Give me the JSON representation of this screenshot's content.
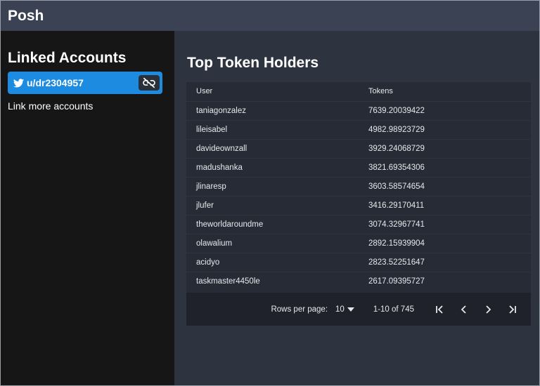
{
  "app": {
    "title": "Posh"
  },
  "sidebar": {
    "heading": "Linked Accounts",
    "account": {
      "username": "u/dr2304957",
      "icon": "twitter-icon",
      "action_icon": "unlink-icon"
    },
    "link_more": "Link more accounts"
  },
  "main": {
    "title": "Top Token Holders",
    "table": {
      "columns": [
        "User",
        "Tokens"
      ],
      "rows": [
        [
          "taniagonzalez",
          "7639.20039422"
        ],
        [
          "lileisabel",
          "4982.98923729"
        ],
        [
          "davideownzall",
          "3929.24068729"
        ],
        [
          "madushanka",
          "3821.69354306"
        ],
        [
          "jlinaresp",
          "3603.58574654"
        ],
        [
          "jlufer",
          "3416.29170411"
        ],
        [
          "theworldaroundme",
          "3074.32967741"
        ],
        [
          "olawalium",
          "2892.15939904"
        ],
        [
          "acidyo",
          "2823.52251647"
        ],
        [
          "taskmaster4450le",
          "2617.09395727"
        ]
      ]
    },
    "pagination": {
      "rows_per_page_label": "Rows per page:",
      "rows_per_page_value": "10",
      "range": "1-10 of 745"
    }
  },
  "colors": {
    "topbar": "#3b4254",
    "sidebar": "#161616",
    "main": "#2e3340",
    "accent": "#1d8be0"
  }
}
